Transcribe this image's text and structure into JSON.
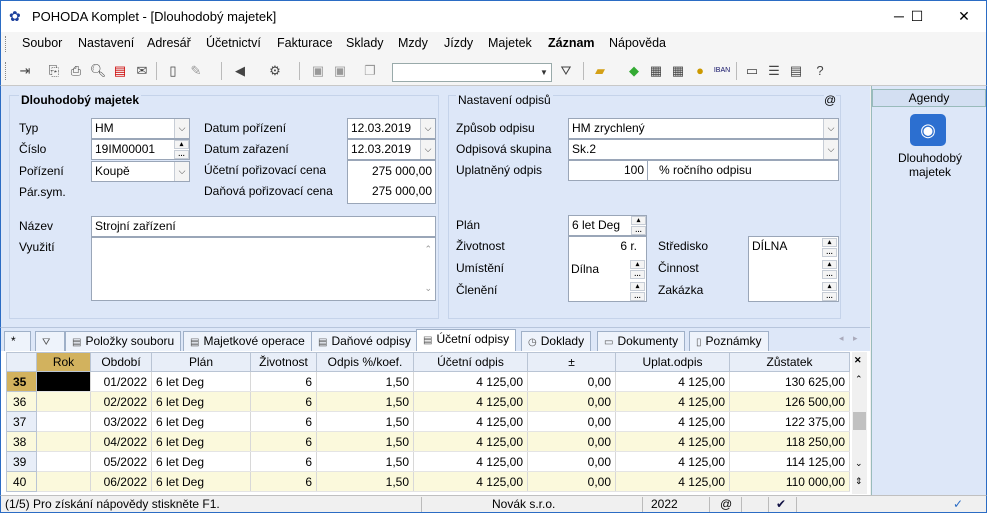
{
  "window": {
    "title": "POHODA Komplet - [Dlouhodobý majetek]"
  },
  "menu": [
    "Soubor",
    "Nastavení",
    "Adresář",
    "Účetnictví",
    "Fakturace",
    "Sklady",
    "Mzdy",
    "Jízdy",
    "Majetek",
    "Záznam",
    "Nápověda"
  ],
  "form": {
    "section_title": "Dlouhodobý majetek",
    "typ": {
      "label": "Typ",
      "value": "HM"
    },
    "cislo": {
      "label": "Číslo",
      "value": "19IM00001"
    },
    "porizeni": {
      "label": "Pořízení",
      "value": "Koupě"
    },
    "parsym": {
      "label": "Pár.sym."
    },
    "datum_porizeni": {
      "label": "Datum pořízení",
      "value": "12.03.2019"
    },
    "datum_zarazeni": {
      "label": "Datum zařazení",
      "value": "12.03.2019"
    },
    "ucetni_cena": {
      "label": "Účetní pořizovací cena",
      "value": "275 000,00"
    },
    "danova_cena": {
      "label": "Daňová pořizovací cena",
      "value": "275 000,00"
    },
    "nazev": {
      "label": "Název",
      "value": "Strojní zařízení"
    },
    "vyuziti": {
      "label": "Využití",
      "value": ""
    }
  },
  "odpisy": {
    "section_title": "Nastavení odpisů",
    "at": "@",
    "zpusob": {
      "label": "Způsob odpisu",
      "value": "HM zrychlený"
    },
    "skupina": {
      "label": "Odpisová skupina",
      "value": "Sk.2"
    },
    "uplatneny": {
      "label": "Uplatněný odpis",
      "value": "100",
      "suffix": "% ročního odpisu"
    },
    "plan": {
      "label": "Plán",
      "value": "6 let Deg"
    },
    "zivotnost": {
      "label": "Životnost",
      "value": "6 r."
    },
    "umisteni": {
      "label": "Umístění",
      "value": "Dílna"
    },
    "cleneni": {
      "label": "Členění"
    },
    "stredisko": {
      "label": "Středisko",
      "value": "DÍLNA"
    },
    "cinnost": {
      "label": "Činnost"
    },
    "zakazka": {
      "label": "Zakázka"
    }
  },
  "sidebar": {
    "header": "Agendy",
    "item": "Dlouhodobý majetek"
  },
  "tabs": [
    {
      "label": "*",
      "icon": "asterisk-icon"
    },
    {
      "label": "",
      "icon": "filter-icon"
    },
    {
      "label": "Položky souboru",
      "icon": "list-icon"
    },
    {
      "label": "Majetkové operace",
      "icon": "list-icon"
    },
    {
      "label": "Daňové odpisy",
      "icon": "list-icon"
    },
    {
      "label": "Účetní odpisy",
      "icon": "list-icon"
    },
    {
      "label": "Doklady",
      "icon": "clock-icon"
    },
    {
      "label": "Dokumenty",
      "icon": "folder-icon"
    },
    {
      "label": "Poznámky",
      "icon": "note-icon"
    }
  ],
  "table": {
    "headers": [
      "Rok",
      "Období",
      "Plán",
      "Životnost",
      "Odpis %/koef.",
      "Účetní odpis",
      "±",
      "Uplat.odpis",
      "Zůstatek"
    ],
    "rows": [
      {
        "no": "35",
        "rok": "",
        "obdobi": "01/2022",
        "plan": "6 let Deg",
        "zivotnost": "6",
        "odpis": "1,50",
        "ucetni": "4 125,00",
        "pm": "0,00",
        "uplat": "4 125,00",
        "zustatek": "130 625,00"
      },
      {
        "no": "36",
        "rok": "",
        "obdobi": "02/2022",
        "plan": "6 let Deg",
        "zivotnost": "6",
        "odpis": "1,50",
        "ucetni": "4 125,00",
        "pm": "0,00",
        "uplat": "4 125,00",
        "zustatek": "126 500,00"
      },
      {
        "no": "37",
        "rok": "",
        "obdobi": "03/2022",
        "plan": "6 let Deg",
        "zivotnost": "6",
        "odpis": "1,50",
        "ucetni": "4 125,00",
        "pm": "0,00",
        "uplat": "4 125,00",
        "zustatek": "122 375,00"
      },
      {
        "no": "38",
        "rok": "",
        "obdobi": "04/2022",
        "plan": "6 let Deg",
        "zivotnost": "6",
        "odpis": "1,50",
        "ucetni": "4 125,00",
        "pm": "0,00",
        "uplat": "4 125,00",
        "zustatek": "118 250,00"
      },
      {
        "no": "39",
        "rok": "",
        "obdobi": "05/2022",
        "plan": "6 let Deg",
        "zivotnost": "6",
        "odpis": "1,50",
        "ucetni": "4 125,00",
        "pm": "0,00",
        "uplat": "4 125,00",
        "zustatek": "114 125,00"
      },
      {
        "no": "40",
        "rok": "",
        "obdobi": "06/2022",
        "plan": "6 let Deg",
        "zivotnost": "6",
        "odpis": "1,50",
        "ucetni": "4 125,00",
        "pm": "0,00",
        "uplat": "4 125,00",
        "zustatek": "110 000,00"
      }
    ]
  },
  "status": {
    "hint": "(1/5) Pro získání nápovědy stiskněte F1.",
    "company": "Novák s.r.o.",
    "year": "2022",
    "at": "@"
  }
}
